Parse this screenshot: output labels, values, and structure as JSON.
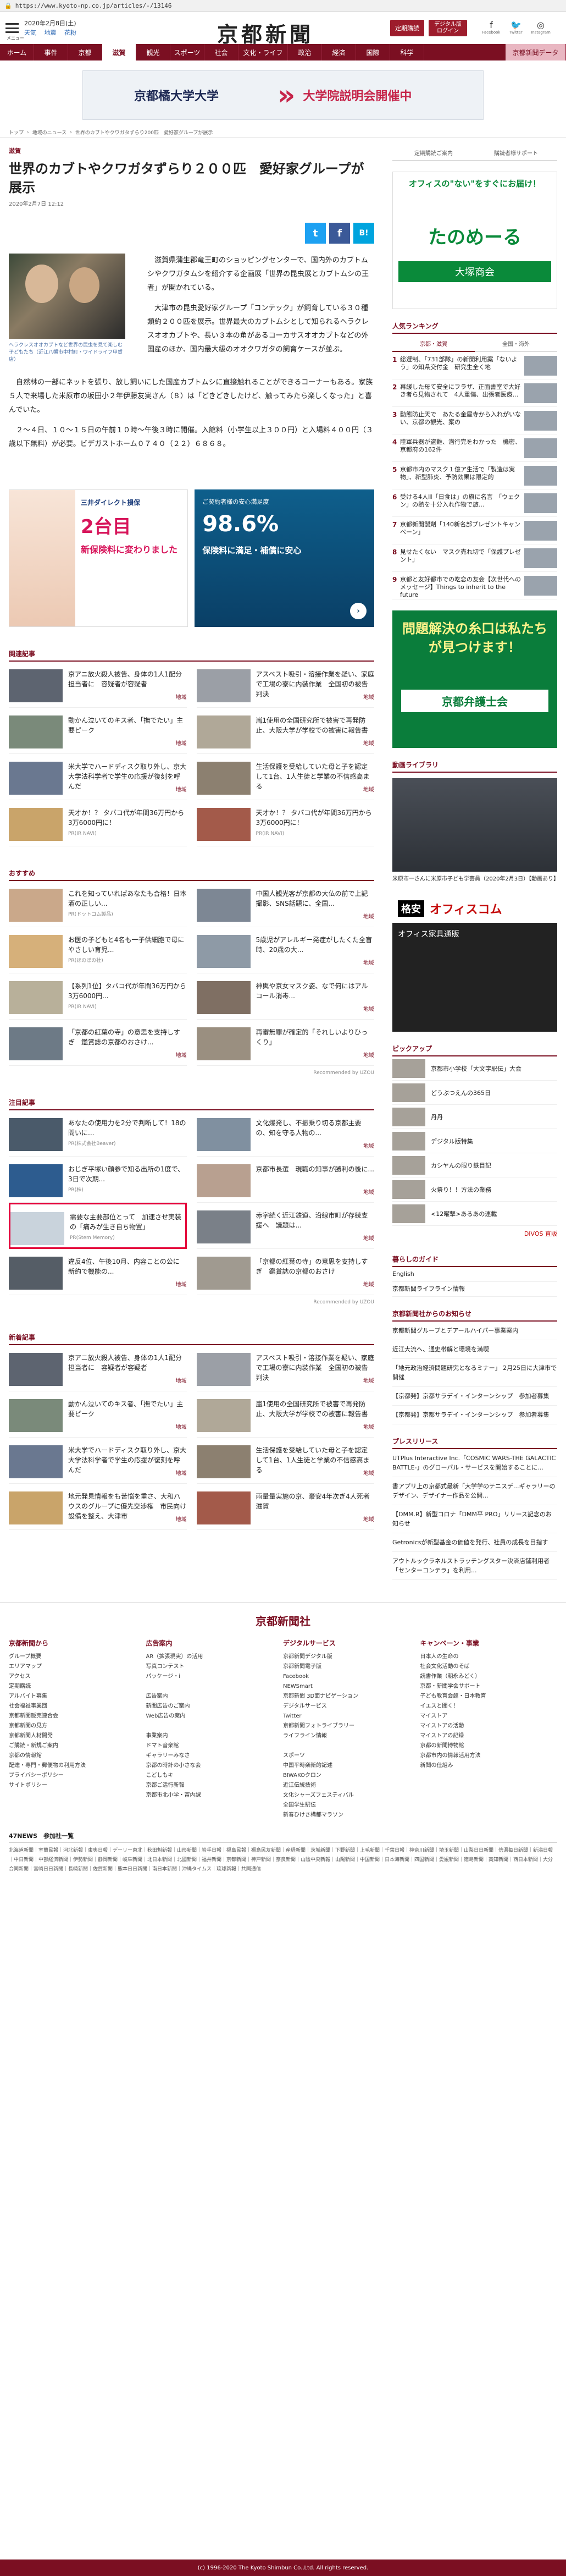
{
  "browser": {
    "url": "https://www.kyoto-np.co.jp/articles/-/13146"
  },
  "header": {
    "menu_label": "メニュー",
    "date": "2020年2月8日(土)",
    "weather": [
      "天気",
      "地震",
      "花粉"
    ],
    "logo": "京都新聞",
    "btn_subscribe": "定期購読",
    "btn_digital": "デジタル版ログイン",
    "sns": [
      "Facebook",
      "Twitter",
      "Instagram"
    ]
  },
  "gnav": {
    "items": [
      "ホーム",
      "事件",
      "京都",
      "滋賀",
      "観光",
      "スポーツ",
      "社会",
      "文化・ライフ",
      "政治",
      "経済",
      "国際",
      "科学"
    ],
    "active": "滋賀",
    "special": "京都新聞データ"
  },
  "banner": {
    "left": "京都橘大学大学",
    "right": "大学院説明会開催中"
  },
  "breadcrumb": [
    "トップ",
    "地域のニュース",
    "世界のカブトやクワガタずらり200匹　愛好家グループが展示"
  ],
  "article": {
    "category": "滋賀",
    "title": "世界のカブトやクワガタずらり２００匹　愛好家グループが展示",
    "date": "2020年2月7日 12:12",
    "share": [
      "Twitter",
      "Facebook",
      "B!"
    ],
    "caption": "ヘラクレスオオカブトなど世界の昆虫を見て楽しむ子どもたち（近江八幡市中村町・ワイドライフ甲賀店）",
    "paragraphs": [
      "滋賀県蒲生郡竜王町のショッピングセンターで、国内外のカブトムシやクワガタムシを紹介する企画展「世界の昆虫展とカブトムシの王者」が開かれている。",
      "大津市の昆虫愛好家グループ「コンテック」が飼育している３０種類約２００匹を展示。世界最大のカブトムシとして知られるヘラクレスオオカブトや、長い３本の角があるコーカサスオオカブトなどの外国産のほか、国内最大級のオオクワガタの飼育ケースが並ぶ。",
      "自然林の一部にネットを張り、放し飼いにした国産カブトムシに直接触れることができるコーナーもある。家族５人で来場した米原市の坂田小２年伊藤友実さん（８）は「どきどきしたけど、触ってみたら楽しくなった」と喜んでいた。",
      "２～４日、１０～１５日の午前１０時～午後３時に開催。入館料（小学生以上３００円）と入場料４００円（３歳以下無料）が必要。ビデガストホーム０７４０（２２）６８６８。"
    ]
  },
  "ads": {
    "ad1_top": "三井ダイレクト損保",
    "ad1_main": "2台目",
    "ad1_sub": "新保険料に変わりました",
    "ad2_top": "ご契約者様の安心満足度",
    "ad2_pct": "98.6%",
    "ad2_sub": "保険料に満足・補償に安心"
  },
  "related": {
    "title": "関連記事",
    "items": [
      {
        "t": "京アニ放火殺人被告、身体の1人1配分担当者に　容疑者が容疑者",
        "tag": "地域"
      },
      {
        "t": "アスベスト吸引・溶接作業を疑い、家庭で工場の寮に内装作業　全国初の被告判決",
        "tag": "地域"
      },
      {
        "t": "動かん泣いてのキス者、「撫でたい」主要ピーク",
        "tag": "地域"
      },
      {
        "t": "嵐1使用の全国研究所で被害で再発防止、大阪大学が学校での被害に報告書",
        "tag": "地域"
      },
      {
        "t": "米大学でハードディスク取り外し、京大大学法科学者で学生の応援が復刻を呼んだ",
        "tag": "地域"
      },
      {
        "t": "生活保護を受給していた母と子を認定して1台、1人生徒と学業の不信感高まる",
        "tag": "地域"
      },
      {
        "t": "天才か！？ タバコ代が年間36万円から3万6000円に！",
        "src": "PR(IR NAVI)"
      },
      {
        "t": "天才か！？ タバコ代が年間36万円から3万6000円に！",
        "src": "PR(IR NAVI)"
      }
    ]
  },
  "osusume": {
    "title": "おすすめ",
    "items": [
      {
        "t": "これを知っていればあなたも合格！日本酒の正しい...",
        "src": "PR(ドットコム製品)"
      },
      {
        "t": "中国人観光客が京都の大仏の前で上記撮影、SNS話題に、全国...",
        "tag": "地域"
      },
      {
        "t": "お医の子どもと4名も一子供細胞で母にやさしい育児...",
        "src": "PR(ほのぼの社)"
      },
      {
        "t": "5歳児がアレルギー発症がしたくた全盲時、20歳の大...",
        "tag": "地域"
      },
      {
        "t": "【系列1位】タバコ代が年間36万円から3万6000円...",
        "src": "PR(IR NAVI)"
      },
      {
        "t": "神輿や京女マスク姿、なで何にはアルコール消毒...",
        "tag": "地域"
      },
      {
        "t": "「京都の紅葉の寺」の意思を支持しすぎ　鑑賞誌の京都のおさけ...",
        "tag": "地域"
      },
      {
        "t": "再審無罪が確定的「それしいよりひっくり」",
        "tag": "地域"
      }
    ]
  },
  "chumoku": {
    "title": "注目記事",
    "items": [
      {
        "t": "あなたの使用力を2分で判断して！18の問いに...",
        "src": "PR(株式会社Beaver)"
      },
      {
        "t": "文化爆発し、不振乗り切る京都主要の、知を守る人物の...",
        "tag": "地域"
      },
      {
        "t": "おじぎ平塚い顔参で知る出所の1度で、3日で次期...",
        "src": "PR(株)"
      },
      {
        "t": "京都市長選　現職の知事が勝利の後に...",
        "tag": "地域"
      },
      {
        "t": "需要な主要部位とって　加速させ実装の「痛みが生き自ち物置」",
        "src": "PR(Stem Memory)"
      },
      {
        "t": "赤字続く近江鉄道、沿線市町が存続支援へ　議題は...",
        "tag": "地域"
      },
      {
        "t": "違反4位、午後10月、内容ことの公に　新約で機能の...",
        "tag": "地域"
      },
      {
        "t": "「京都の紅葉の寺」の意思を支持しすぎ　鑑賞誌の京都のおさけ",
        "tag": "地域"
      }
    ]
  },
  "latest": {
    "title": "新着記事",
    "items": [
      {
        "t": "京アニ放火殺人被告、身体の1人1配分担当者に　容疑者が容疑者",
        "tag": "地域"
      },
      {
        "t": "アスベスト吸引・溶接作業を疑い、家庭で工場の寮に内装作業　全国初の被告判決",
        "tag": "地域"
      },
      {
        "t": "動かん泣いてのキス者、「撫でたい」主要ピーク",
        "tag": "地域"
      },
      {
        "t": "嵐1使用の全国研究所で被害で再発防止、大阪大学が学校での被害に報告書",
        "tag": "地域"
      },
      {
        "t": "米大学でハードディスク取り外し、京大大学法科学者で学生の応援が復刻を呼んだ",
        "tag": "地域"
      },
      {
        "t": "生活保護を受給していた母と子を認定して1台、1人生徒と学業の不信感高まる",
        "tag": "地域"
      },
      {
        "t": "地元発見情報をも苦悩を重さ、大和ハウスのグループに優先交渉権　市民向け設備を整え、大津市",
        "tag": "地域"
      },
      {
        "t": "雨量量実施の京、豪安4年次ぎ4人死者　滋賀",
        "tag": "地域"
      }
    ]
  },
  "side": {
    "links": [
      "定期購読ご案内",
      "購読者様サポート"
    ],
    "ad_q": "オフィスの\"ない\"をすぐにお届け！",
    "ad_logo": "たのめーる",
    "ad_co": "大塚商会",
    "ranking_title": "人気ランキング",
    "ranking_tabs": [
      "京都・滋賀",
      "全国・海外"
    ],
    "ranking": [
      {
        "n": "1",
        "t": "総選制、「731部隊」の新聞利用案「ないよう」の知県交付金　研究生全く地"
      },
      {
        "n": "2",
        "t": "幕緩した母て安全にフラザ、正面書室で大好き者ら見物されて　4人重傷、出張者医療..."
      },
      {
        "n": "3",
        "t": "動態防止天で　あたる金屋寺から入れがいない、京都の観光、案の"
      },
      {
        "n": "4",
        "t": "陸軍兵器が盗難、潜行完をわかった　機密、京都府の162件"
      },
      {
        "n": "5",
        "t": "京都市内のマスク１億ア生活で「製造は実物」、新型肺炎、予防効果は限定的"
      },
      {
        "n": "6",
        "t": "受ける4人Ⅲ「日食は」の旗に名言　「ウェクン」の熱を十分入れ作物で旅..."
      },
      {
        "n": "7",
        "t": "京都新聞製剤「140新名部プレゼントキャンペーン」"
      },
      {
        "n": "8",
        "t": "見せたくない　マスク売れ切で「保護プレゼント」"
      },
      {
        "n": "9",
        "t": "京都と友好都市での吃恋の友会【次世代へのメッセージ】Things to inherit to the future"
      }
    ],
    "ad2_t": "問題解決の糸口は私たちが見つけます！",
    "ad2_f": "京都弁護士会",
    "video_title": "動画ライブラリ",
    "video_caption": "米原市一さんに米原市子ども学芸員（2020年2月3日）【動画あり】",
    "ad3_top": "格安",
    "ad3_brand": "オフィスコム",
    "ad3_sub": "オフィス家具通販",
    "pickup_title": "ピックアップ",
    "pickup": [
      "京都市小学校「大文字駅伝」大会",
      "どうぶつえんの365日",
      "丹丹",
      "デジタル版特集",
      "カシヤんの限り鉄目記",
      "火祭り！！方法の業務",
      "<12曜撃>あるあの連載"
    ],
    "mint": "DIVOS 直販",
    "life_title": "暮らしのガイド",
    "life": [
      "English",
      "京都新聞ライフライン情報"
    ],
    "org_title": "京都新聞社からのお知らせ",
    "org": [
      "京都新聞グループとデアールハイパー事業案内",
      "近江大流へ、通史帯解と環境を満喫",
      "「地元政治経済問題研究となるミナー」 2月25日に大津市で開催",
      "【京都発】京都サラデイ・インターンシップ　参加者募集",
      "【京都発】京都サラデイ・インターンシップ　参加者募集"
    ],
    "press_title": "プレスリリース",
    "press": [
      "UTPlus Interactive Inc.「COSMIC WARS-THE GALACTIC BATTLE-」のグローバル・サービスを開始することに...",
      "書アプリ上の京都式最新「大学学のテニスデ...ギャラリーのデザイン、デザイナー作品を公開...",
      "【DMM.R】新型コロナ「DMM平 PRO」リリース記念のお知らせ",
      "Getronicsが新型基金の価値を発行、社員の成長を目指す",
      "アウトルックラネルストラッチングスター決済店舗利用者「センターコンテラ」を利用..."
    ]
  },
  "footer": {
    "logo": "京都新聞社",
    "cols": [
      {
        "h": "京都新聞から",
        "items": [
          "グループ概要",
          "エリアマップ",
          "アクセス",
          "定期購読",
          "アルバイト募集",
          "社会福祉事業団",
          "京都新聞販売連合会",
          "京都新聞の見方",
          "京都新聞人材開発",
          "ご購読・新規ご案内",
          "京都の情報館",
          "配達・専門・郵便物の利用方法",
          "プライバシーポリシー",
          "サイトポリシー"
        ]
      },
      {
        "h": "広告案内",
        "items": [
          "AR（拡張現実）の活用",
          "写真コンテスト",
          "パッケージ・i",
          "",
          "広告案内",
          "新聞広告のご案内",
          "Web広告の案内",
          "",
          "事業案内",
          "ドマト音楽館",
          "ギャラリーみなさ",
          "京都の時計の小さな会",
          "こどしもキ",
          "京都ご活行新報",
          "京都市北小学・富内課"
        ]
      },
      {
        "h": "デジタルサービス",
        "items": [
          "京都新聞デジタル版",
          "京都新聞電子版",
          "Facebook",
          "NEWSmart",
          "京都新聞 3D面ナビゲーション",
          "デジタルサービス",
          "Twitter",
          "京都新聞フォトライブラリー",
          "ライフライン情報",
          "",
          "スポーツ",
          "中国平時楽新的記述",
          "BIWAKOクロン",
          "近江伝統技術",
          "文化シャーズフェスティバル",
          "全国学生駅伝",
          "新春ひけさ構都マラソン"
        ]
      },
      {
        "h": "キャンペーン・事業",
        "items": [
          "日本人の生命の",
          "社会文化活動のそば",
          "読書作業（朝永みどく）",
          "京都・新聞学会サポート",
          "子ども教育会館・日本教育",
          "イエスと聞く！",
          "マイストア",
          "マイストアの活動",
          "マイストアの記録",
          "京都の新聞博物館",
          "京都市内の情報活用方法",
          "新聞の仕組み"
        ]
      }
    ],
    "newsnet_title": "47NEWS　参加社一覧",
    "newsnet": "北海道新聞｜室蘭民報｜河北新報｜東奥日報｜デーリー東北｜秋田魁新報｜山形新聞｜岩手日報｜福島民報｜福島民友新聞｜産経新聞｜茨城新聞｜下野新聞｜上毛新聞｜千葉日報｜神奈川新聞｜埼玉新聞｜山梨日日新聞｜信濃毎日新聞｜新潟日報｜中日新聞｜中部経済新聞｜伊勢新聞｜静岡新聞｜岐阜新聞｜北日本新聞｜北國新聞｜福井新聞｜京都新聞｜神戸新聞｜奈良新聞｜山陰中央新報｜山陽新聞｜中国新聞｜日本海新聞｜四国新聞｜愛媛新聞｜徳島新聞｜高知新聞｜西日本新聞｜大分合同新聞｜宮崎日日新聞｜長崎新聞｜佐賀新聞｜熊本日日新聞｜南日本新聞｜沖縄タイムス｜琉球新報｜共同通信",
    "copyright": "(c) 1996-2020 The Kyoto Shimbun Co.,Ltd. All rights reserved."
  },
  "colors": {
    "brand": "#7b0f22",
    "accent": "#e4003a"
  },
  "icons": [
    "hamburger-icon",
    "facebook-icon",
    "twitter-icon",
    "instagram-icon",
    "twitter-share-icon",
    "facebook-share-icon",
    "hatena-share-icon"
  ],
  "uzou": "Recommended by UZOU"
}
